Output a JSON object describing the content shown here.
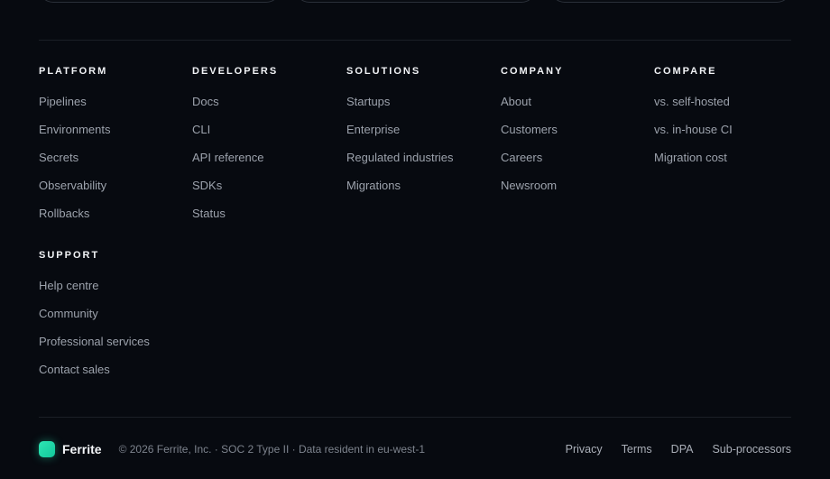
{
  "columns": {
    "platform": {
      "heading": "PLATFORM",
      "links": [
        "Pipelines",
        "Environments",
        "Secrets",
        "Observability",
        "Rollbacks"
      ]
    },
    "developers": {
      "heading": "DEVELOPERS",
      "links": [
        "Docs",
        "CLI",
        "API reference",
        "SDKs",
        "Status"
      ]
    },
    "solutions": {
      "heading": "SOLUTIONS",
      "links": [
        "Startups",
        "Enterprise",
        "Regulated industries",
        "Migrations"
      ]
    },
    "company": {
      "heading": "COMPANY",
      "links": [
        "About",
        "Customers",
        "Careers",
        "Newsroom"
      ]
    },
    "compare": {
      "heading": "COMPARE",
      "links": [
        "vs. self-hosted",
        "vs. in-house CI",
        "Migration cost"
      ]
    },
    "support": {
      "heading": "SUPPORT",
      "links": [
        "Help centre",
        "Community",
        "Professional services",
        "Contact sales"
      ]
    }
  },
  "footer": {
    "brand": "Ferrite",
    "copyright": "© 2026 Ferrite, Inc. · SOC 2 Type II · Data resident in eu-west-1",
    "links": [
      "Privacy",
      "Terms",
      "DPA",
      "Sub-processors"
    ]
  },
  "colors": {
    "background": "#070a10",
    "accent": "#1fd6a6",
    "heading": "#f1f3f6",
    "link": "#9ca2ac"
  }
}
